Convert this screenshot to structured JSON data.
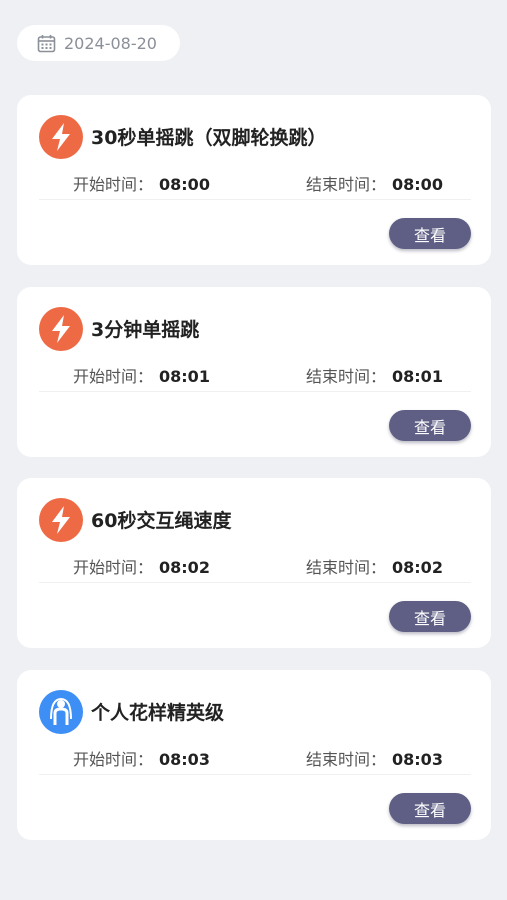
{
  "header": {
    "date": "2024-08-20",
    "calendar_icon": "calendar-icon"
  },
  "labels": {
    "start": "开始时间：",
    "end": "结束时间：",
    "view": "查看"
  },
  "colors": {
    "lightning_icon_bg": "#ee6a45",
    "person_icon_bg": "#3d8ef5",
    "button_bg": "#5f5f86"
  },
  "items": [
    {
      "title": "30秒单摇跳（双脚轮换跳）",
      "icon": "lightning-icon",
      "start": "08:00",
      "end": "08:00"
    },
    {
      "title": "3分钟单摇跳",
      "icon": "lightning-icon",
      "start": "08:01",
      "end": "08:01"
    },
    {
      "title": "60秒交互绳速度",
      "icon": "lightning-icon",
      "start": "08:02",
      "end": "08:02"
    },
    {
      "title": "个人花样精英级",
      "icon": "jump-rope-person-icon",
      "start": "08:03",
      "end": "08:03"
    }
  ]
}
